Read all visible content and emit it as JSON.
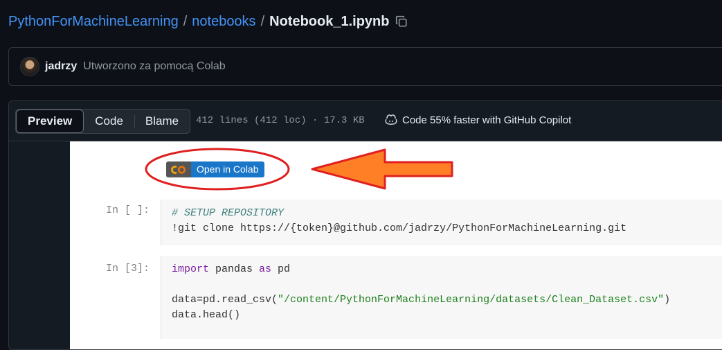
{
  "breadcrumb": {
    "repo": "PythonForMachineLearning",
    "sep1": "/",
    "folder": "notebooks",
    "sep2": "/",
    "file": "Notebook_1.ipynb",
    "copy_icon": "copy-icon"
  },
  "commit": {
    "author": "jadrzy",
    "message": "Utworzono za pomocą Colab"
  },
  "file_header": {
    "tabs": [
      {
        "label": "Preview",
        "active": true
      },
      {
        "label": "Code",
        "active": false
      },
      {
        "label": "Blame",
        "active": false
      }
    ],
    "meta": "412 lines (412 loc) · 17.3 KB",
    "copilot_text": "Code 55% faster with GitHub Copilot"
  },
  "notebook": {
    "badge_label": "Open in Colab",
    "badge_logo": "CO",
    "cells": [
      {
        "prompt": "In [ ]:",
        "lines": [
          "# SETUP REPOSITORY",
          "!git clone https://{token}@github.com/jadrzy/PythonForMachineLearning.git"
        ]
      },
      {
        "prompt": "In [3]:",
        "line1_kw": "import",
        "line1_rest": " pandas ",
        "line1_kw2": "as",
        "line1_end": " pd",
        "line3_pre": "data=pd.read_csv(",
        "line3_str": "\"/content/PythonForMachineLearning/datasets/Clean_Dataset.csv\"",
        "line3_post": ")",
        "line4": "data.head()"
      }
    ]
  },
  "colors": {
    "link": "#4493f8",
    "annotation_red": "#e02020",
    "annotation_orange": "#ff7f27",
    "colab_blue": "#1976c8"
  }
}
